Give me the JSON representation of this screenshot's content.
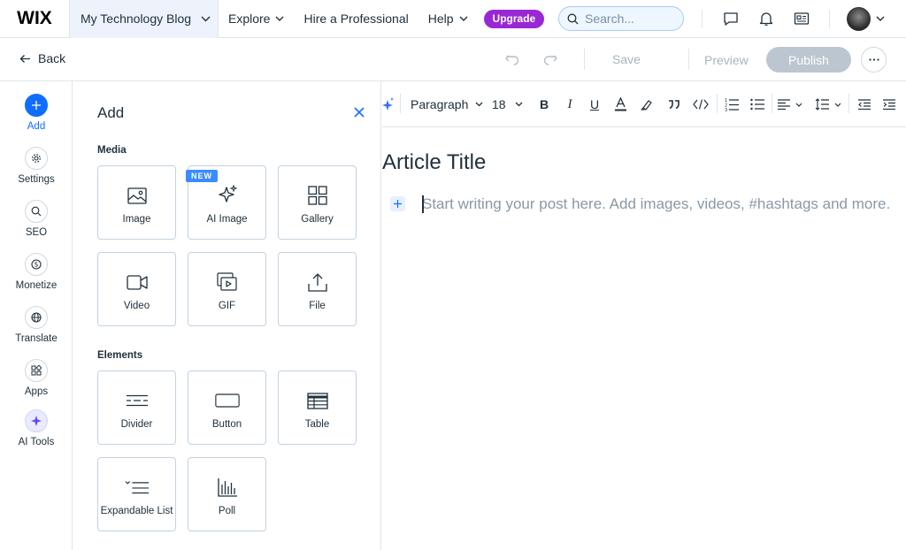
{
  "topbar": {
    "logo": "WIX",
    "site_name": "My Technology Blog",
    "nav": [
      {
        "label": "Explore"
      },
      {
        "label": "Hire a Professional"
      },
      {
        "label": "Help"
      }
    ],
    "upgrade_label": "Upgrade",
    "search_placeholder": "Search..."
  },
  "actionbar": {
    "back_label": "Back",
    "save_label": "Save",
    "preview_label": "Preview",
    "publish_label": "Publish"
  },
  "rail": {
    "items": [
      {
        "label": "Add",
        "icon": "plus-icon"
      },
      {
        "label": "Settings",
        "icon": "gear-icon"
      },
      {
        "label": "SEO",
        "icon": "search-icon"
      },
      {
        "label": "Monetize",
        "icon": "dollar-icon"
      },
      {
        "label": "Translate",
        "icon": "globe-icon"
      },
      {
        "label": "Apps",
        "icon": "apps-icon"
      },
      {
        "label": "AI Tools",
        "icon": "sparkle-icon"
      }
    ]
  },
  "panel": {
    "title": "Add",
    "media_title": "Media",
    "elements_title": "Elements",
    "new_badge": "NEW",
    "media": [
      {
        "label": "Image"
      },
      {
        "label": "AI Image"
      },
      {
        "label": "Gallery"
      },
      {
        "label": "Video"
      },
      {
        "label": "GIF"
      },
      {
        "label": "File"
      }
    ],
    "elements": [
      {
        "label": "Divider"
      },
      {
        "label": "Button"
      },
      {
        "label": "Table"
      },
      {
        "label": "Expandable List"
      },
      {
        "label": "Poll"
      }
    ]
  },
  "editor": {
    "paragraph_style": "Paragraph",
    "font_size": "18",
    "article_title": "Article Title",
    "body_placeholder": "Start writing your post here. Add images, videos, #hashtags and more."
  },
  "colors": {
    "accent": "#116dff",
    "upgrade": "#9a27d5",
    "publish_disabled": "#bcc6d0"
  }
}
